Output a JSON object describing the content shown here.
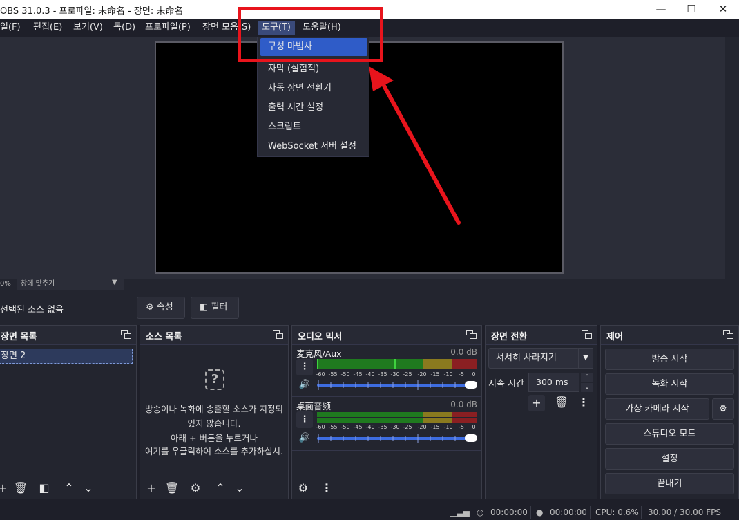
{
  "window": {
    "title": "OBS 31.0.3 - 프로파일: 未命名 - 장면: 未命名",
    "minimize": "—",
    "maximize": "☐",
    "close": "✕"
  },
  "menubar": [
    {
      "label": "파일(F)"
    },
    {
      "label": "편집(E)"
    },
    {
      "label": "보기(V)"
    },
    {
      "label": "독(D)"
    },
    {
      "label": "프로파일(P)"
    },
    {
      "label": "장면 모음(S)"
    },
    {
      "label": "도구(T)"
    },
    {
      "label": "도움말(H)"
    }
  ],
  "tools_menu": [
    {
      "label": "구성 마법사"
    },
    {
      "label": "자막 (실험적)"
    },
    {
      "label": "자동 장면 전환기"
    },
    {
      "label": "출력 시간 설정"
    },
    {
      "label": "스크립트"
    },
    {
      "label": "WebSocket 서버 설정"
    }
  ],
  "zoom": {
    "percent": "0%",
    "mode": "창에 맞추기"
  },
  "context": {
    "no_source": "선택된 소스 없음",
    "properties": "속성",
    "filters": "필터"
  },
  "scenes": {
    "title": "장면 목록",
    "items": [
      "장면 2"
    ]
  },
  "sources": {
    "title": "소스 목록",
    "empty_lines": [
      "방송이나 녹화에 송출할 소스가 지정되",
      "있지 않습니다.",
      "아래 + 버튼을 누르거나",
      "여기를 우클릭하여 소스를 추가하십시."
    ]
  },
  "mixer": {
    "title": "오디오 믹서",
    "channels": [
      {
        "name": "麦克风/Aux",
        "db": "0.0 dB"
      },
      {
        "name": "桌面音频",
        "db": "0.0 dB"
      }
    ],
    "scale": [
      "-60",
      "-55",
      "-50",
      "-45",
      "-40",
      "-35",
      "-30",
      "-25",
      "-20",
      "-15",
      "-10",
      "-5",
      "0"
    ],
    "colors": {
      "green": "#1f7a1f",
      "yellow": "#8a7a1f",
      "red": "#8a1f22",
      "bright_green": "#3fd13f",
      "fader": "#3d6ce0"
    }
  },
  "transitions": {
    "title": "장면 전환",
    "selected": "서서히 사라지기",
    "duration_label": "지속 시간",
    "duration_value": "300 ms"
  },
  "controls": {
    "title": "제어",
    "start_streaming": "방송 시작",
    "start_recording": "녹화 시작",
    "start_virtual_camera": "가상 카메라 시작",
    "studio_mode": "스튜디오 모드",
    "settings": "설정",
    "exit": "끝내기"
  },
  "status": {
    "stream_time": "00:00:00",
    "record_time": "00:00:00",
    "cpu": "CPU: 0.6%",
    "fps": "30.00 / 30.00 FPS"
  },
  "annotation": {
    "color": "#e8141c"
  }
}
